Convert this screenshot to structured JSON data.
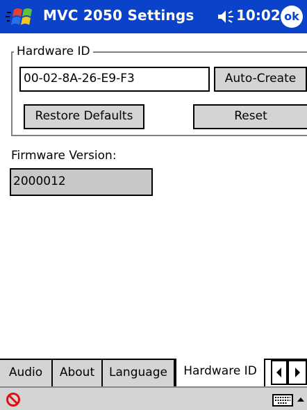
{
  "titlebar": {
    "title": "MVC 2050 Settings",
    "clock": "10:02",
    "ok_label": "ok",
    "icons": {
      "start": "windows-flag-icon",
      "speaker": "speaker-icon"
    }
  },
  "hardware_group": {
    "legend": "Hardware ID",
    "id_value": "00-02-8A-26-E9-F3",
    "auto_create_label": "Auto-Create",
    "restore_label": "Restore Defaults",
    "reset_label": "Reset"
  },
  "firmware": {
    "label": "Firmware Version:",
    "value": "2000012"
  },
  "tabs": [
    {
      "label": "Audio"
    },
    {
      "label": "About"
    },
    {
      "label": "Language"
    },
    {
      "label": "Hardware ID",
      "active": true
    }
  ],
  "menubar": {
    "icons": [
      "no-entry-icon",
      "keyboard-icon",
      "up-arrow-icon"
    ]
  },
  "colors": {
    "titlebar_bg": "#0a43c9",
    "button_bg": "#d4d4d4",
    "readonly_bg": "#c8c8c8"
  }
}
